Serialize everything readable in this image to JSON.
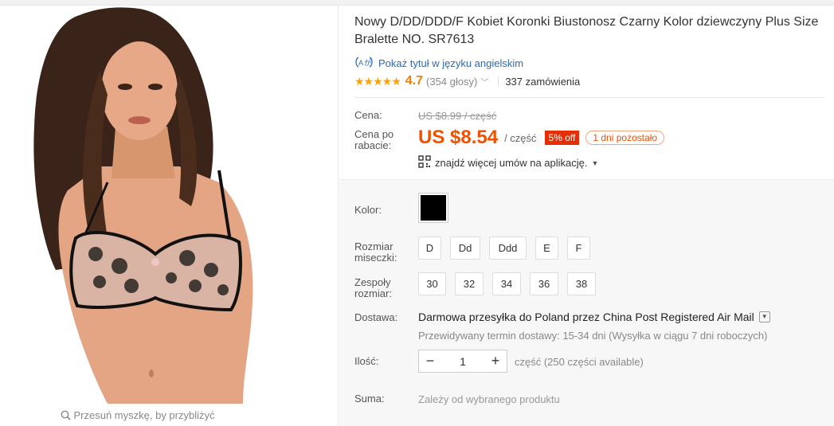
{
  "gallery": {
    "zoom_hint": "Przesuń myszkę, by przybliżyć"
  },
  "product": {
    "title": "Nowy D/DD/DDD/F Kobiet Koronki Biustonosz Czarny Kolor dziewczyny Plus Size Bralette NO. SR7613",
    "translate_link": "Pokaż tytuł w języku angielskim",
    "rating": {
      "stars": "★★★★★",
      "score": "4.7",
      "votes": "(354 głosy)",
      "orders": "337 zamówienia",
      "value": 4.7
    }
  },
  "price": {
    "label_price": "Cena:",
    "old_price": "US $8.99 / część",
    "label_discount": "Cena po rabacie:",
    "new_price": "US $8.54",
    "unit": "/ część",
    "off_badge": "5% off",
    "days_left": "1 dni pozostało",
    "app_deals": "znajdź więcej umów na aplikację."
  },
  "options": {
    "color_label": "Kolor:",
    "color_value": "#000000",
    "cup_label": "Rozmiar miseczki:",
    "cup_sizes": [
      "D",
      "Dd",
      "Ddd",
      "E",
      "F"
    ],
    "band_label": "Zespoły rozmiar:",
    "band_sizes": [
      "30",
      "32",
      "34",
      "36",
      "38"
    ]
  },
  "shipping": {
    "label": "Dostawa:",
    "main_prefix": "Darmowa przesyłka do",
    "main_suffix": "Poland przez China Post Registered Air Mail",
    "estimate": "Przewidywany termin dostawy: 15-34 dni (Wysyłka w ciągu 7 dni roboczych)"
  },
  "quantity": {
    "label": "Ilość:",
    "minus": "−",
    "value": "1",
    "plus": "+",
    "note": "część (250 części available)"
  },
  "total": {
    "label": "Suma:",
    "note": "Zależy od wybranego produktu"
  },
  "colors": {
    "price": "#f25000",
    "badge": "#e62e04",
    "link": "#2e6ab6",
    "star": "#ffa200"
  }
}
